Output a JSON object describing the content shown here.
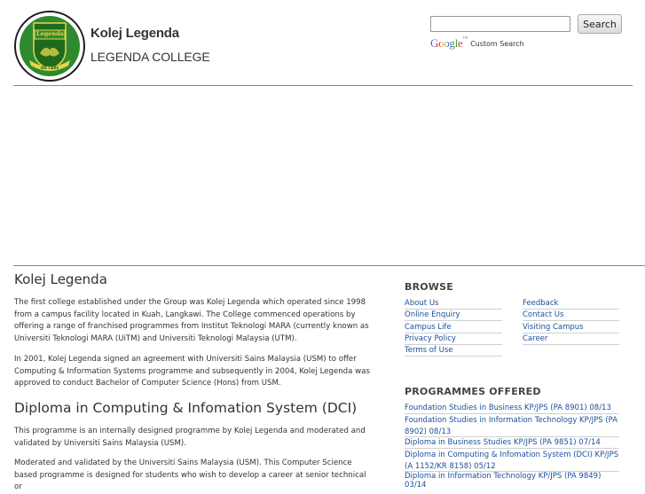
{
  "header": {
    "logo": {
      "emblem_text": "Legenda",
      "ribbon_text": "WE CARE"
    },
    "college_name": "Kolej Legenda",
    "college_name_en": "LEGENDA COLLEGE"
  },
  "search": {
    "input_value": "",
    "button_label": "Search",
    "google_text": "Google",
    "google_tm": "™",
    "custom_search_label": "Custom Search"
  },
  "main": {
    "title": "Kolej Legenda",
    "para1": "The first college established under the Group was Kolej Legenda which operated since 1998 from a campus facility located in Kuah, Langkawi. The College commenced operations by offering a range of franchised programmes from Institut Teknologi MARA (currently known as Universiti Teknologi MARA (UiTM) and Universiti Teknologi Malaysia (UTM).",
    "para2": "In 2001, Kolej Legenda signed an agreement with Universiti Sains Malaysia (USM) to offer Computing & Information Systems programme and subsequently in 2004, Kolej Legenda was approved to conduct Bachelor of Computer Science (Hons) from USM.",
    "subtitle": "Diploma in Computing & Infomation System (DCI)",
    "para3": "This programme is an internally designed programme by Kolej Legenda and moderated and validated by Universiti Sains Malaysia (USM).",
    "para4": "Moderated and validated by the Universiti Sains Malaysia (USM). This Computer Science based programme is designed for students who wish to develop a career at senior technical or"
  },
  "sidebar": {
    "browse_title": "BROWSE",
    "browse_left": [
      "About Us",
      "Online Enquiry",
      "Campus Life",
      "Privacy Policy",
      "Terms of Use"
    ],
    "browse_right": [
      "Feedback",
      "Contact Us",
      "Visiting Campus",
      "Career"
    ],
    "programmes_title": "PROGRAMMES OFFERED",
    "programmes": [
      "Foundation Studies in Business KP/JPS (PA 8901) 08/13",
      "Foundation Studies in Information Technology KP/JPS (PA 8902) 08/13",
      "Diploma in Business Studies KP/JPS (PA 9851) 07/14",
      "Diploma in Computing & Infomation System (DCI) KP/JPS (A 1152/KR 8158) 05/12",
      "Diploma in Information Technology KP/JPS (PA 9849) 03/14"
    ]
  },
  "colors": {
    "link": "#1a4f9a",
    "rule": "#888888",
    "logo_green": "#2f8a2f"
  }
}
